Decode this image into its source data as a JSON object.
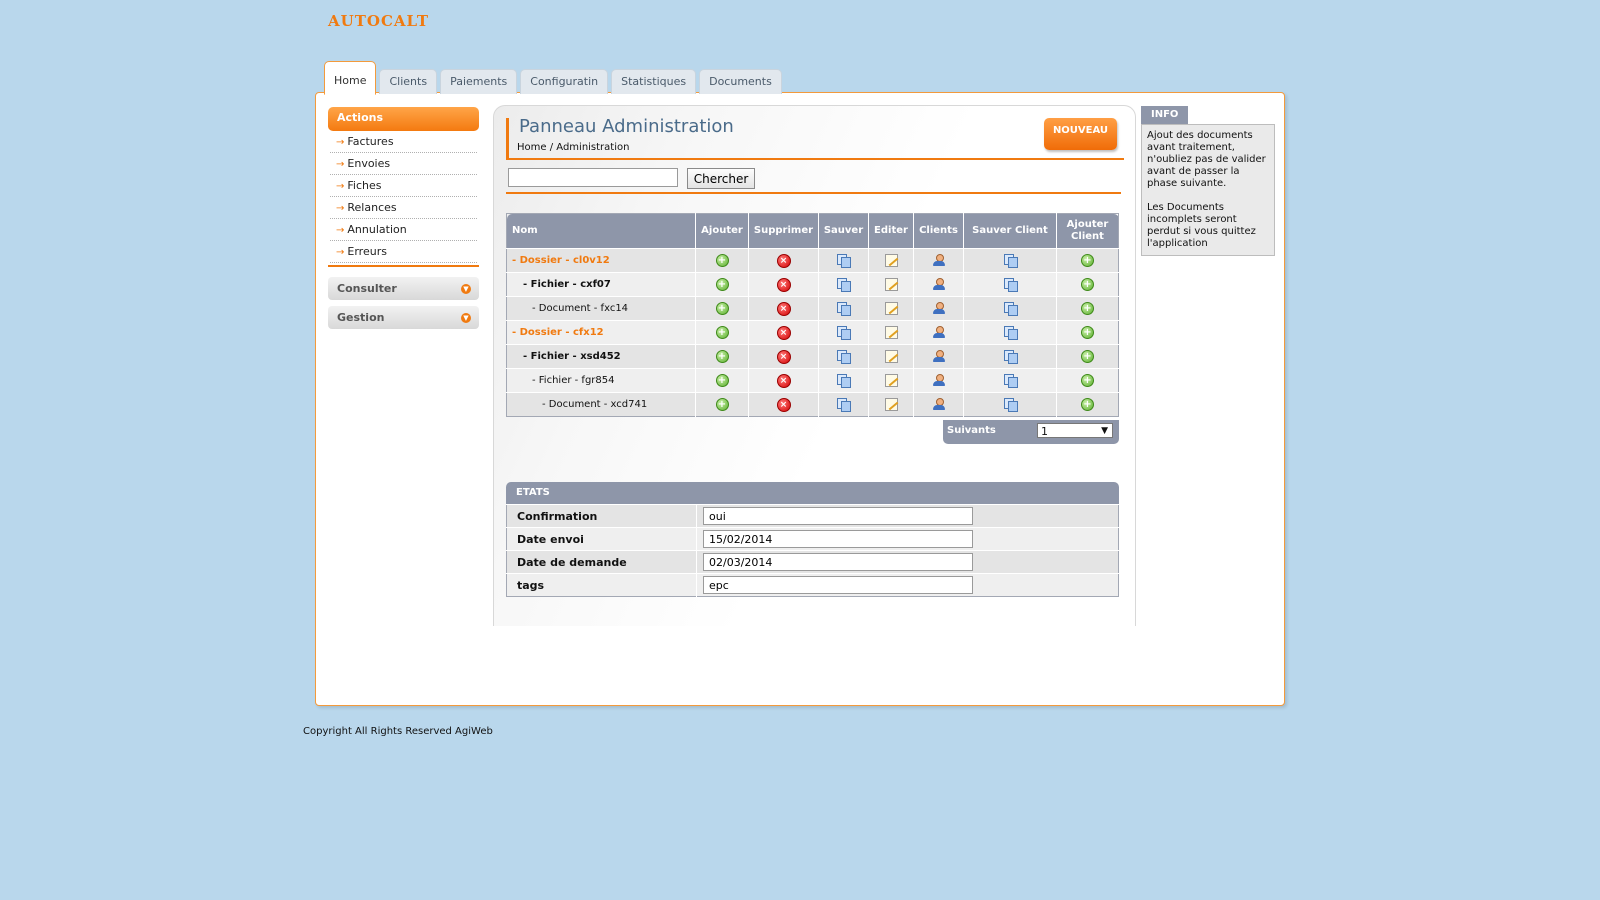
{
  "app": {
    "logo_text": "AUTOCALT"
  },
  "tabs": [
    {
      "label": "Home",
      "active": true
    },
    {
      "label": "Clients"
    },
    {
      "label": "Paiements"
    },
    {
      "label": "Configuratin"
    },
    {
      "label": "Statistiques"
    },
    {
      "label": "Documents"
    }
  ],
  "sidebar": {
    "actions_title": "Actions",
    "items": [
      "Factures",
      "Envoies",
      "Fiches",
      "Relances",
      "Annulation",
      "Erreurs"
    ],
    "sections": [
      "Consulter",
      "Gestion"
    ]
  },
  "panel": {
    "title": "Panneau Administration",
    "breadcrumb": [
      "Home",
      "Administration"
    ],
    "breadcrumb_sep": "/",
    "new_button": "NOUVEAU",
    "search": {
      "value": "",
      "button": "Chercher"
    }
  },
  "grid": {
    "columns": [
      "Nom",
      "Ajouter",
      "Supprimer",
      "Sauver",
      "Editer",
      "Clients",
      "Sauver Client",
      "Ajouter Client"
    ],
    "rows": [
      {
        "name": "- Dossier - cl0v12",
        "kind": "dossier",
        "level": 0
      },
      {
        "name": "- Fichier - cxf07",
        "kind": "fichier",
        "level": 1
      },
      {
        "name": "- Document - fxc14",
        "kind": "doc",
        "level": 2
      },
      {
        "name": "- Dossier - cfx12",
        "kind": "dossier",
        "level": 0
      },
      {
        "name": "- Fichier - xsd452",
        "kind": "fichier",
        "level": 1
      },
      {
        "name": "- Fichier - fgr854",
        "kind": "doc",
        "level": 2
      },
      {
        "name": "- Document - xcd741",
        "kind": "doc",
        "level": 3
      }
    ],
    "row_icons": [
      "add-icon",
      "delete-icon",
      "copy-icon",
      "edit-icon",
      "user-icon",
      "copy-icon",
      "add-icon"
    ],
    "pager": {
      "label": "Suivants",
      "value": "1"
    }
  },
  "etats": {
    "title": "ETATS",
    "fields": [
      {
        "label": "Confirmation",
        "value": "oui"
      },
      {
        "label": "Date envoi",
        "value": "15/02/2014"
      },
      {
        "label": "Date de demande",
        "value": "02/03/2014"
      },
      {
        "label": "tags",
        "value": "epc"
      }
    ]
  },
  "info": {
    "title": "INFO",
    "paragraphs": [
      "Ajout des documents avant traitement, n'oubliez pas de valider avant de passer la phase suivante.",
      "Les Documents incomplets seront perdut si vous quittez l'application"
    ]
  },
  "footer": {
    "text": "Copyright All Rights Reserved AgiWeb"
  },
  "colors": {
    "accent": "#f07a10",
    "background": "#b9d7ec",
    "table_header": "#8e96a9",
    "title": "#4a6b8a"
  }
}
